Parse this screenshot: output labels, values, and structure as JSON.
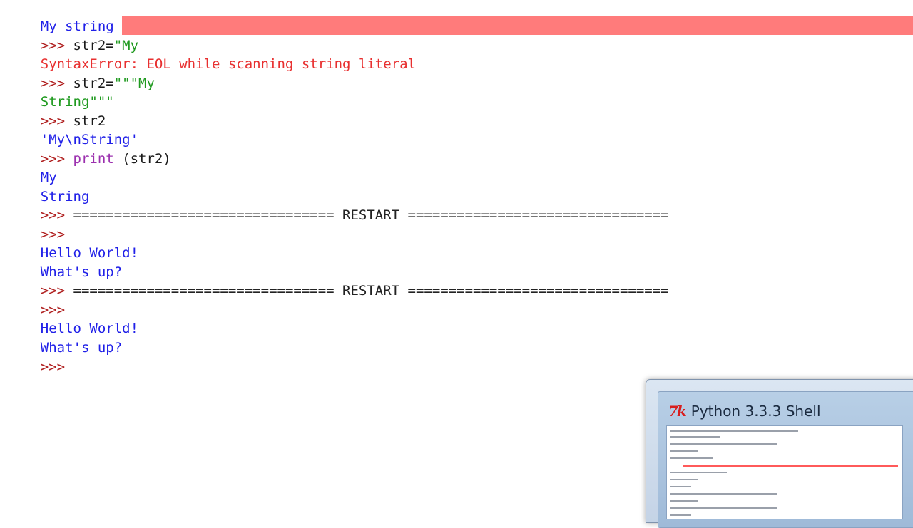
{
  "shell": {
    "lines": {
      "l0": {
        "text": "My string"
      },
      "l1": {
        "prompt": ">>>",
        "code": " str2=",
        "string": "\"My"
      },
      "l2": {
        "text": "SyntaxError: EOL while scanning string literal"
      },
      "l3": {
        "prompt": ">>>",
        "code": " str2=",
        "string": "\"\"\"My"
      },
      "l4": {
        "string": "String\"\"\""
      },
      "l5": {
        "prompt": ">>>",
        "code": " str2"
      },
      "l6": {
        "text": "'My\\nString'"
      },
      "l7": {
        "prompt": ">>>",
        "keyword": " print",
        "code": " (str2)"
      },
      "l8": {
        "text": "My"
      },
      "l9": {
        "text": "String"
      },
      "l10": {
        "prompt": ">>>",
        "code": " ================================ RESTART ================================"
      },
      "l11": {
        "prompt": ">>>"
      },
      "l12": {
        "text": "Hello World!"
      },
      "l13": {
        "text": "What's up?"
      },
      "l14": {
        "prompt": ">>>",
        "code": " ================================ RESTART ================================"
      },
      "l15": {
        "prompt": ">>>"
      },
      "l16": {
        "text": "Hello World!"
      },
      "l17": {
        "text": "What's up?"
      },
      "l18": {
        "prompt": ">>>"
      }
    }
  },
  "taskbar_thumbnail": {
    "title": "Python 3.3.3 Shell",
    "icon": "tk-icon"
  },
  "colors": {
    "prompt": "#b02020",
    "output": "#2020e8",
    "string": "#1f9a1f",
    "keyword": "#9b2fae",
    "error": "#e83030",
    "error_highlight": "#ff7b7b"
  }
}
